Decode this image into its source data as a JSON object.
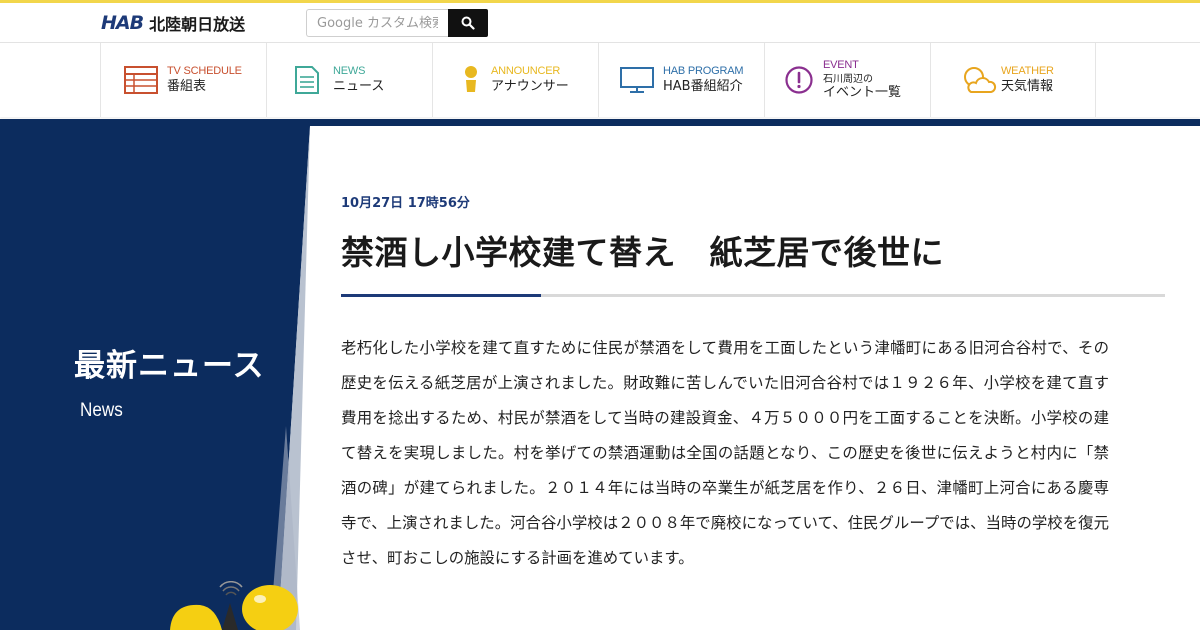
{
  "header": {
    "logo_mark": "HAB",
    "logo_name": "北陸朝日放送",
    "search_placeholder": "Google カスタム検索"
  },
  "nav": {
    "items": [
      {
        "en": "TV SCHEDULE",
        "ja": "番組表",
        "color": "#c8502f",
        "icon": "tv-schedule-icon"
      },
      {
        "en": "NEWS",
        "ja": "ニュース",
        "color": "#3fa898",
        "icon": "news-icon"
      },
      {
        "en": "ANNOUNCER",
        "ja": "アナウンサー",
        "color": "#e8b820",
        "icon": "announcer-icon"
      },
      {
        "en": "HAB PROGRAM",
        "ja": "HAB番組紹介",
        "color": "#2e6fa8",
        "icon": "monitor-icon"
      },
      {
        "en": "EVENT",
        "ja_small": "石川周辺の",
        "ja": "イベント一覧",
        "color": "#8a2f8f",
        "icon": "exclamation-icon"
      },
      {
        "en": "WEATHER",
        "ja": "天気情報",
        "color": "#e8a51e",
        "icon": "weather-icon"
      }
    ]
  },
  "sidebar": {
    "title": "最新ニュース",
    "subtitle": "News"
  },
  "article": {
    "date": "10月27日 17時56分",
    "title": "禁酒し小学校建て替え　紙芝居で後世に",
    "body": "老朽化した小学校を建て直すために住民が禁酒をして費用を工面したという津幡町にある旧河合谷村で、その歴史を伝える紙芝居が上演されました。財政難に苦しんでいた旧河合谷村では１９２６年、小学校を建て直す費用を捻出するため、村民が禁酒をして当時の建設資金、４万５０００円を工面することを決断。小学校の建て替えを実現しました。村を挙げての禁酒運動は全国の話題となり、この歴史を後世に伝えようと村内に「禁酒の碑」が建てられました。２０１４年には当時の卒業生が紙芝居を作り、２６日、津幡町上河合にある慶専寺で、上演されました。河合谷小学校は２００８年で廃校になっていて、住民グループでは、当時の学校を復元させ、町おこしの施設にする計画を進めています。"
  },
  "colors": {
    "navy": "#0c2c5e",
    "accent_yellow": "#f2d64b",
    "mascot_yellow": "#f5cf12"
  }
}
